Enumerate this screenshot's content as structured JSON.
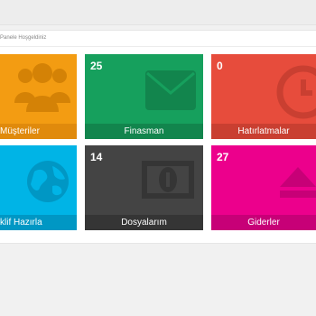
{
  "header": {
    "welcome_text": "Panele Hoşgeldiniz"
  },
  "tiles": [
    {
      "label": "Müşteriler",
      "count": "",
      "color": "#f39c12",
      "band": "#e08a0c",
      "icon": "users-icon"
    },
    {
      "label": "Finasman",
      "count": "25",
      "color": "#16a05d",
      "band": "#12854d",
      "icon": "envelope-icon"
    },
    {
      "label": "Hatırlatmalar",
      "count": "0",
      "color": "#e74c3c",
      "band": "#c93f31",
      "icon": "clock-icon"
    },
    {
      "label": "klif Hazırla",
      "count": "",
      "color": "#00b4e6",
      "band": "#0097c4",
      "icon": "globe-icon"
    },
    {
      "label": "Dosyalarım",
      "count": "14",
      "color": "#444444",
      "band": "#353535",
      "icon": "money-icon"
    },
    {
      "label": "Giderler",
      "count": "27",
      "color": "#ec008c",
      "band": "#c70077",
      "icon": "eject-icon"
    }
  ]
}
